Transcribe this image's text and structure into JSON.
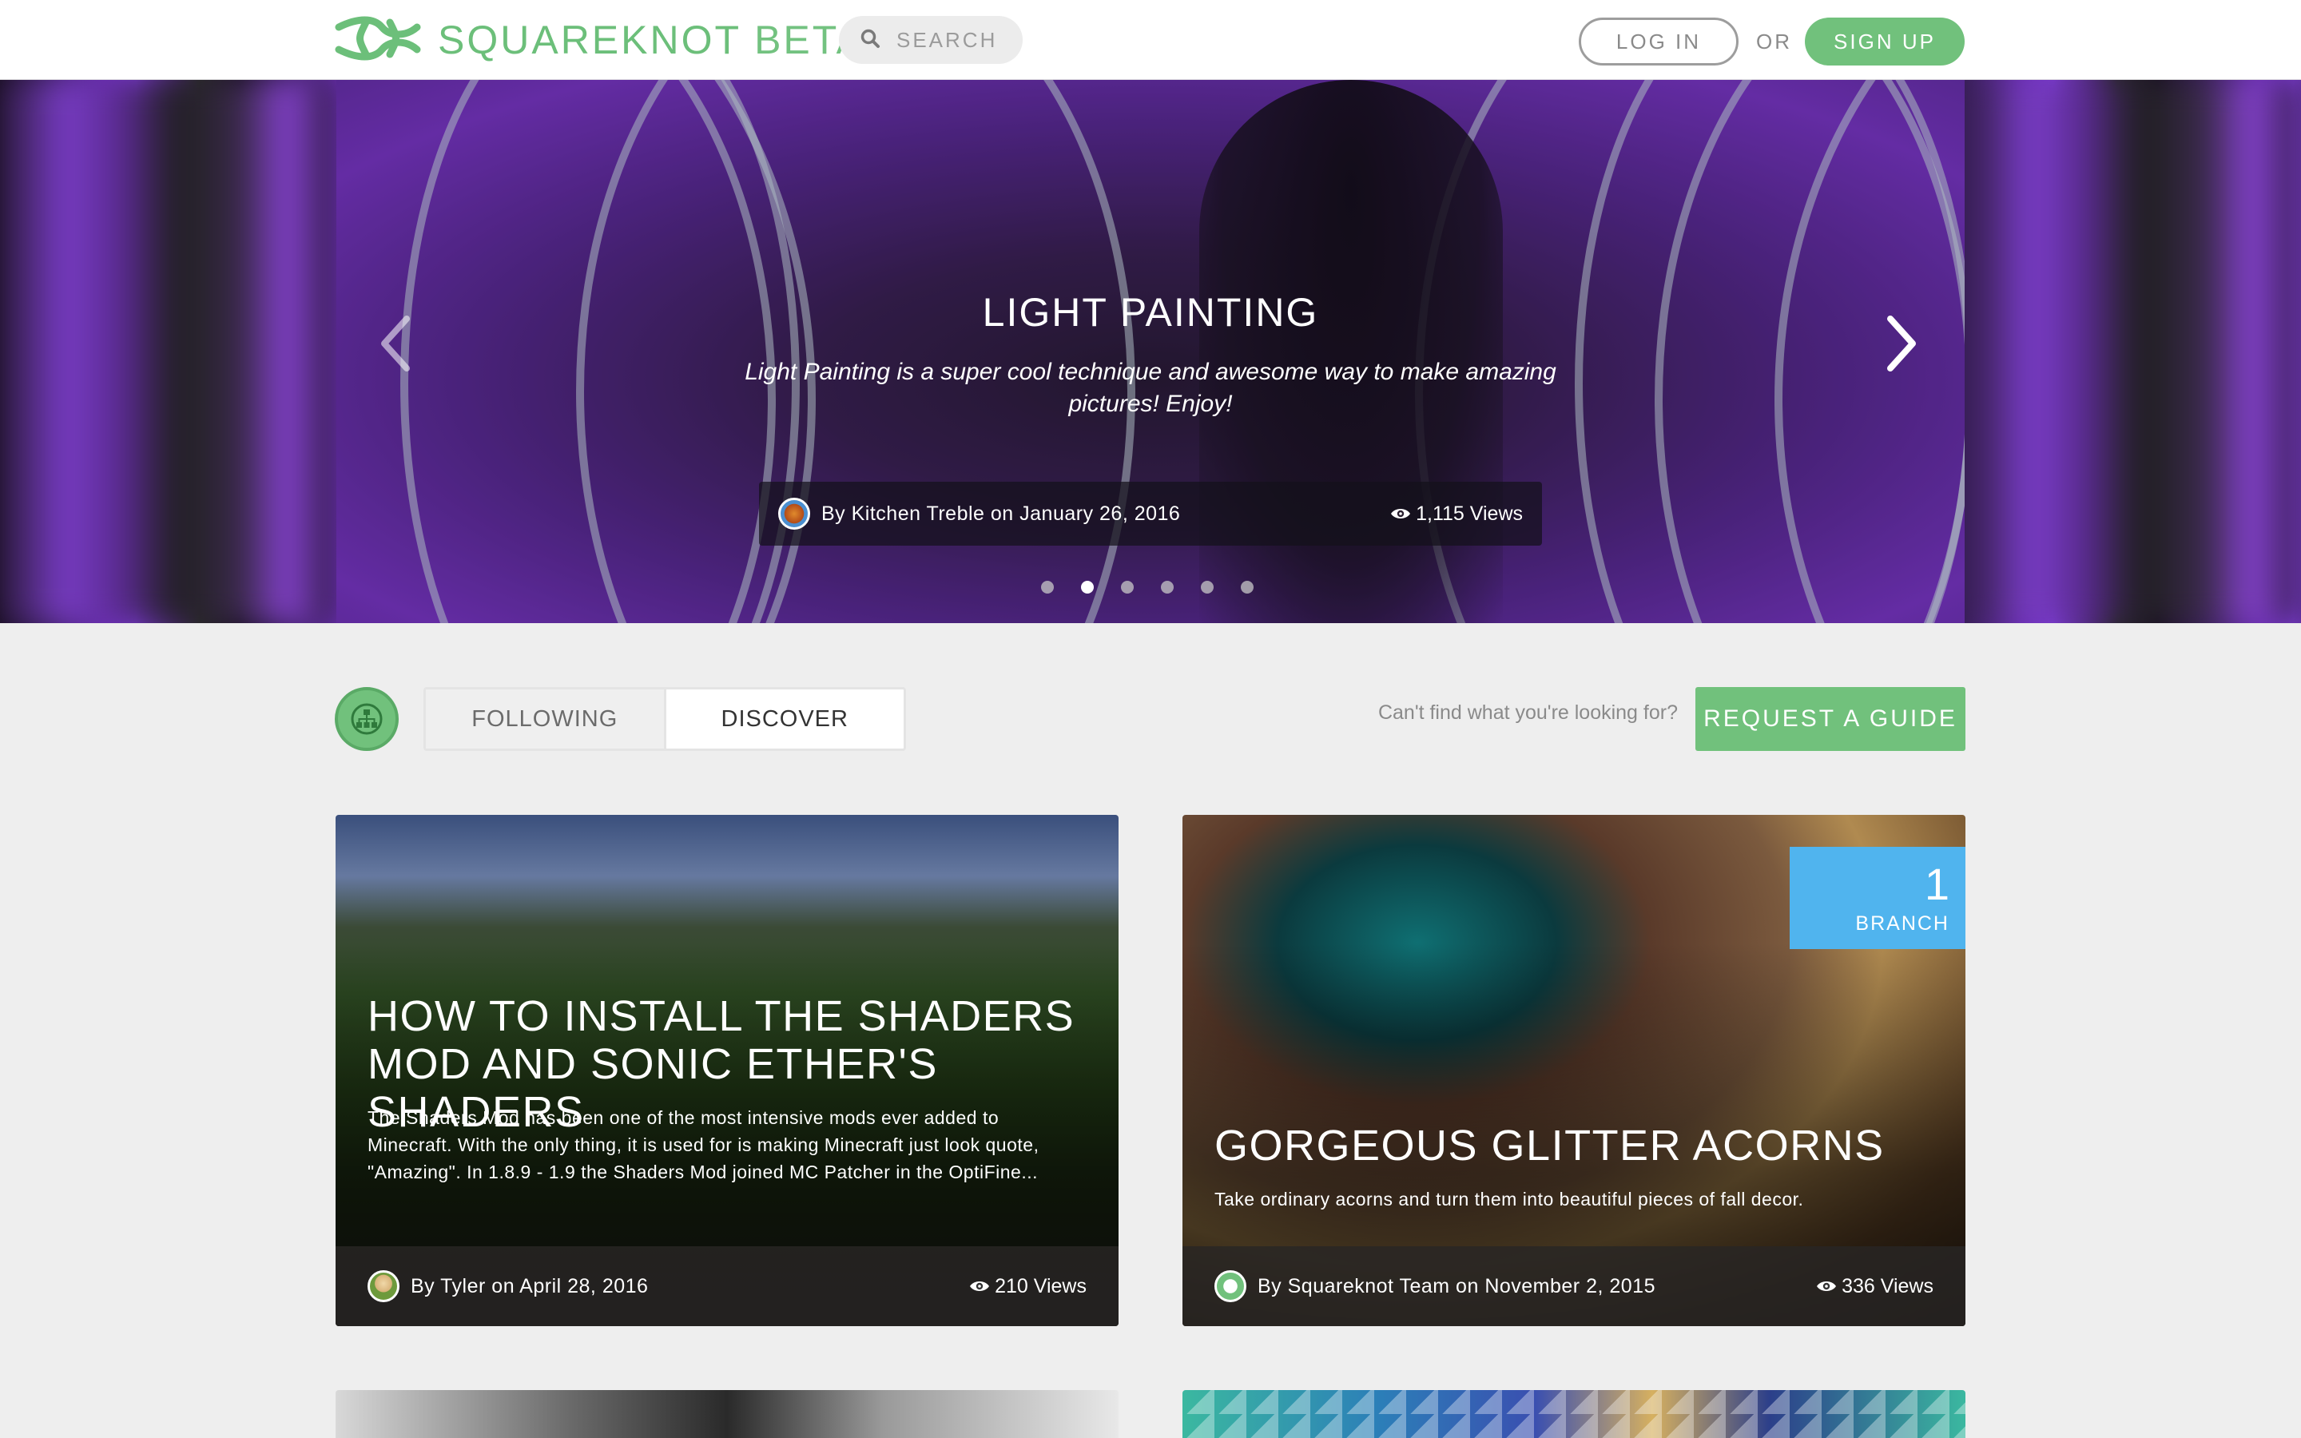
{
  "header": {
    "brand": "SQUAREKNOT",
    "brand_suffix": "BETA",
    "search_placeholder": "SEARCH",
    "login_label": "LOG IN",
    "or_label": "OR",
    "signup_label": "SIGN UP"
  },
  "hero": {
    "title": "LIGHT PAINTING",
    "description": "Light Painting is a super cool technique and awesome way to make amazing pictures! Enjoy!",
    "byline": "By Kitchen Treble on January 26, 2016",
    "views": "1,115 Views",
    "slide_count": 6,
    "active_slide": 2
  },
  "tabs": {
    "following": "FOLLOWING",
    "discover": "DISCOVER",
    "active": "discover"
  },
  "help": {
    "text": "Can't find what you're looking for?",
    "request_label": "REQUEST A GUIDE"
  },
  "cards": [
    {
      "title": "HOW TO INSTALL THE SHADERS MOD AND SONIC ETHER'S SHADERS",
      "description": "The Shaders Mod has been one of the most intensive mods ever added to Minecraft. With the only thing, it is used for is making Minecraft just look quote, \"Amazing\". In 1.8.9 - 1.9 the Shaders Mod joined MC Patcher in the OptiFine...",
      "byline": "By Tyler on April 28, 2016",
      "views": "210 Views"
    },
    {
      "title": "GORGEOUS GLITTER ACORNS",
      "description": "Take ordinary acorns and turn them into beautiful pieces of fall decor.",
      "byline": "By Squareknot Team on November 2, 2015",
      "views": "336 Views",
      "branch_count": "1",
      "branch_label": "BRANCH"
    }
  ],
  "colors": {
    "brand_green": "#71c17c",
    "branch_blue": "#50b4ee",
    "page_bg": "#eeeeee"
  },
  "icons": [
    "knot-logo-icon",
    "search-icon",
    "eye-icon",
    "chevron-left-icon",
    "chevron-right-icon",
    "org-chart-icon"
  ]
}
